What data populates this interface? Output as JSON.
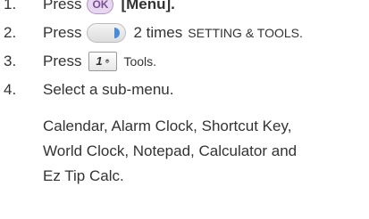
{
  "steps": [
    {
      "number": "1.",
      "press": "Press",
      "ok_button": "OK",
      "menu_label": "[Menu]."
    },
    {
      "number": "2.",
      "press": "Press",
      "times_text": "2 times",
      "target": "SETTING & TOOLS."
    },
    {
      "number": "3.",
      "press": "Press",
      "key_label": "1",
      "target": "Tools."
    },
    {
      "number": "4.",
      "instruction": "Select a sub-menu.",
      "submenu_lines": [
        "Calendar, Alarm Clock, Shortcut Key,",
        "World Clock, Notepad, Calculator and",
        "Ez Tip Calc."
      ]
    }
  ]
}
